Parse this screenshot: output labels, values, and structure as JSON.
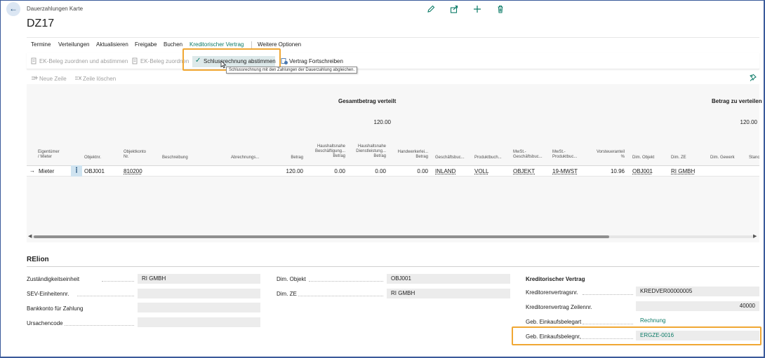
{
  "header": {
    "caption": "Dauerzahlungen Karte",
    "title": "DZ17"
  },
  "menu": {
    "items": [
      {
        "label": "Termine"
      },
      {
        "label": "Verteilungen"
      },
      {
        "label": "Aktualisieren"
      },
      {
        "label": "Freigabe"
      },
      {
        "label": "Buchen"
      },
      {
        "label": "Kreditorischer Vertrag"
      },
      {
        "label": "Weitere Optionen"
      }
    ]
  },
  "toolbar": {
    "ek_zuordnen_abstimmen": "EK-Beleg zuordnen und abstimmen",
    "ek_zuordnen": "EK-Beleg zuordnen",
    "schluss_abstimmen": "Schlussrechnung abstimmen",
    "vertrag_fortschreiben": "Vertrag Fortschreiben",
    "tooltip": "Schlussrechnung mit den Zahlungen der Dauerzahlung abgleichen."
  },
  "lines_toolbar": {
    "neue_zeile": "Neue Zeile",
    "zeile_loeschen": "Zeile löschen"
  },
  "totals": {
    "gesamt_label": "Gesamtbetrag verteilt",
    "gesamt_value": "120.00",
    "zu_verteilen_label": "Betrag zu verteilen",
    "zu_verteilen_value": "120.00"
  },
  "grid": {
    "headers": {
      "eigentuemer_1": "Eigentümer",
      "eigentuemer_2": "/ Mieter",
      "objektnr": "Objektnr.",
      "objektkonto_1": "Objektkonto",
      "objektkonto_2": "Nr.",
      "beschreibung": "Beschreibung",
      "abrechnungs": "Abrechnungs...",
      "betrag": "Betrag",
      "hh_besch_1": "Haushaltsnahe",
      "hh_besch_2": "Beschäftigung...",
      "hh_besch_3": "Betrag",
      "hh_dienst_1": "Haushaltsnahe",
      "hh_dienst_2": "Dienstleistung...",
      "hh_dienst_3": "Betrag",
      "handwerk_1": "Handwerkerlei...",
      "handwerk_2": "Betrag",
      "geschaeftsbuch": "Geschäftsbuc...",
      "produktbuch": "Produktbuch...",
      "mwst_gesch_1": "MwSt.-",
      "mwst_gesch_2": "Geschäftsbuc...",
      "mwst_prod_1": "MwSt.-",
      "mwst_prod_2": "Produktbuc...",
      "vorsteuer_1": "Vorsteueranteil",
      "vorsteuer_2": "%",
      "dim_objekt": "Dim. Objekt",
      "dim_ze": "Dim. ZE",
      "dim_gewerk": "Dim. Gewerk",
      "stand": "Stanc"
    },
    "row": {
      "eigentuemer": "Mieter",
      "objektnr": "OBJ001",
      "objektkonto": "810200",
      "betrag": "120.00",
      "hh_besch": "0.00",
      "hh_dienst": "0.00",
      "handwerk": "0.00",
      "geschaeftsbuch": "INLAND",
      "produktbuch": "VOLL",
      "mwst_gesch": "OBJEKT",
      "mwst_prod": "19-MWST",
      "vorsteuer": "10.96",
      "dim_objekt": "OBJ001",
      "dim_ze": "RI GMBH"
    }
  },
  "relion": {
    "title": "RElion",
    "left": [
      {
        "label": "Zuständigkeitseinheit",
        "value": "RI GMBH"
      },
      {
        "label": "SEV-Einheitennr.",
        "value": ""
      },
      {
        "label": "Bankkonto für Zahlung",
        "value": ""
      },
      {
        "label": "Ursachencode",
        "value": ""
      }
    ],
    "middle": [
      {
        "label": "Dim. Objekt",
        "value": "OBJ001"
      },
      {
        "label": "Dim. ZE",
        "value": "RI GMBH"
      }
    ],
    "right_title": "Kreditorischer Vertrag",
    "right": [
      {
        "label": "Kreditorenvertragsnr.",
        "value": "KREDVER00000005"
      },
      {
        "label": "Kreditorenvertrag Zeilennr.",
        "value": "40000"
      },
      {
        "label": "Geb. Einkaufsbelegart",
        "value": "Rechnung"
      },
      {
        "label": "Geb. Einkaufsbelegnr.",
        "value": "ERGZE-0016"
      }
    ]
  },
  "colors": {
    "accent": "#0a7a66",
    "highlight": "#f0a733",
    "frame": "#3a5a9a"
  }
}
